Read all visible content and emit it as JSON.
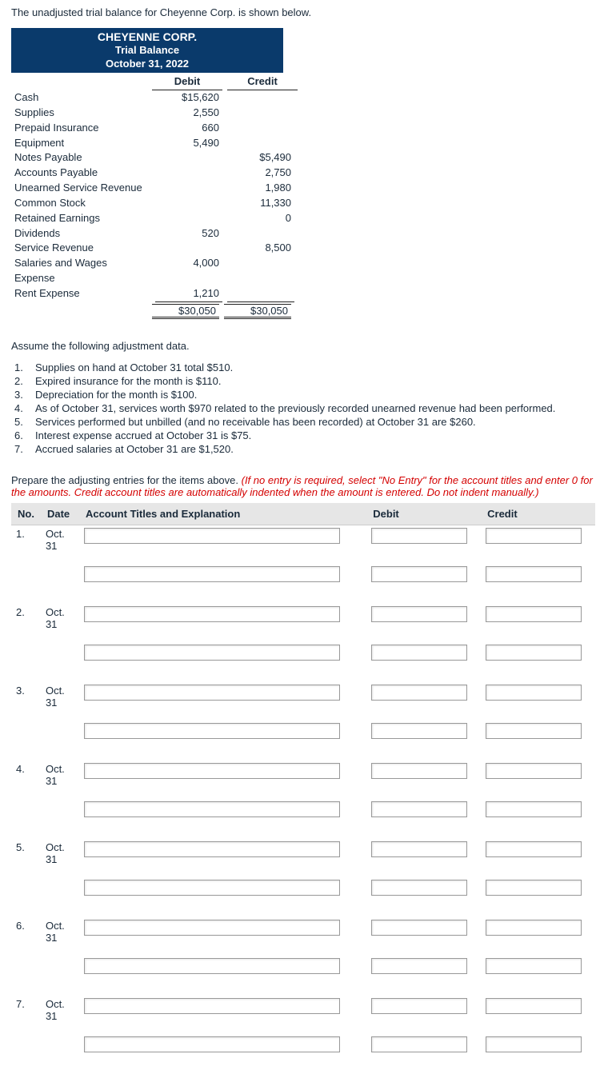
{
  "intro": "The unadjusted trial balance for Cheyenne Corp. is shown below.",
  "tb": {
    "company": "CHEYENNE CORP.",
    "title": "Trial Balance",
    "date": "October 31, 2022",
    "col_debit": "Debit",
    "col_credit": "Credit",
    "rows": [
      {
        "acct": "Cash",
        "debit": "$15,620",
        "credit": ""
      },
      {
        "acct": "Supplies",
        "debit": "2,550",
        "credit": ""
      },
      {
        "acct": "Prepaid Insurance",
        "debit": "660",
        "credit": ""
      },
      {
        "acct": "Equipment",
        "debit": "5,490",
        "credit": ""
      },
      {
        "acct": "Notes Payable",
        "debit": "",
        "credit": "$5,490"
      },
      {
        "acct": "Accounts Payable",
        "debit": "",
        "credit": "2,750"
      },
      {
        "acct": "Unearned Service Revenue",
        "debit": "",
        "credit": "1,980"
      },
      {
        "acct": "Common Stock",
        "debit": "",
        "credit": "11,330"
      },
      {
        "acct": "Retained Earnings",
        "debit": "",
        "credit": "0"
      },
      {
        "acct": "Dividends",
        "debit": "520",
        "credit": ""
      },
      {
        "acct": "Service Revenue",
        "debit": "",
        "credit": "8,500"
      },
      {
        "acct": "Salaries and Wages Expense",
        "debit": "4,000",
        "credit": ""
      },
      {
        "acct": "Rent Expense",
        "debit": "1,210",
        "credit": ""
      }
    ],
    "total_debit": "$30,050",
    "total_credit": "$30,050"
  },
  "assume": "Assume the following adjustment data.",
  "adjustments": [
    {
      "n": "1.",
      "t": "Supplies on hand at October 31 total $510."
    },
    {
      "n": "2.",
      "t": "Expired insurance for the month is $110."
    },
    {
      "n": "3.",
      "t": "Depreciation for the month is $100."
    },
    {
      "n": "4.",
      "t": "As of October 31, services worth $970 related to the previously recorded unearned revenue had been performed."
    },
    {
      "n": "5.",
      "t": "Services performed but unbilled (and no receivable has been recorded) at October 31 are $260."
    },
    {
      "n": "6.",
      "t": "Interest expense accrued at October 31 is $75."
    },
    {
      "n": "7.",
      "t": "Accrued salaries at October 31 are $1,520."
    }
  ],
  "prepare_lead": "Prepare the adjusting entries for the items above. ",
  "prepare_red": "(If no entry is required, select \"No Entry\" for the account titles and enter 0 for the amounts. Credit account titles are automatically indented when the amount is entered. Do not indent manually.)",
  "entry_headers": {
    "no": "No.",
    "date": "Date",
    "title": "Account Titles and Explanation",
    "debit": "Debit",
    "credit": "Credit"
  },
  "entries": [
    {
      "no": "1.",
      "date": "Oct. 31"
    },
    {
      "no": "2.",
      "date": "Oct. 31"
    },
    {
      "no": "3.",
      "date": "Oct. 31"
    },
    {
      "no": "4.",
      "date": "Oct. 31"
    },
    {
      "no": "5.",
      "date": "Oct. 31"
    },
    {
      "no": "6.",
      "date": "Oct. 31"
    },
    {
      "no": "7.",
      "date": "Oct. 31"
    }
  ]
}
